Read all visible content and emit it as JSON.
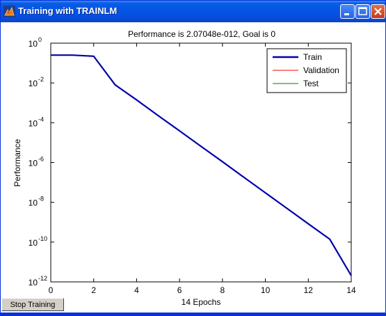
{
  "window": {
    "title": "Training with TRAINLM",
    "icon": "matlab-icon",
    "controls": [
      "minimize-icon",
      "maximize-icon",
      "close-icon"
    ]
  },
  "stop_button_label": "Stop Training",
  "chart_data": {
    "type": "line",
    "title": "Performance is 2.07048e-012, Goal is 0",
    "xlabel": "14 Epochs",
    "ylabel": "Performance",
    "xlim": [
      0,
      14
    ],
    "ylim": [
      1e-12,
      1
    ],
    "yscale": "log",
    "x_ticks": [
      0,
      2,
      4,
      6,
      8,
      10,
      12,
      14
    ],
    "y_tick_exponents": [
      0,
      -2,
      -4,
      -6,
      -8,
      -10,
      -12
    ],
    "grid": false,
    "legend_position": "top-right",
    "series": [
      {
        "name": "Train",
        "color": "#0000aa",
        "x": [
          0,
          1,
          2,
          3,
          4,
          5,
          6,
          7,
          8,
          9,
          10,
          11,
          12,
          13,
          14
        ],
        "y": [
          0.25,
          0.25,
          0.22,
          0.008,
          0.0014,
          0.00023,
          3.9e-05,
          6.5e-06,
          1.1e-06,
          1.8e-07,
          3e-08,
          5e-09,
          8.3e-10,
          1.4e-10,
          2.07048e-12
        ]
      },
      {
        "name": "Validation",
        "color": "#ff0000",
        "x": [],
        "y": []
      },
      {
        "name": "Test",
        "color": "#008000",
        "x": [],
        "y": []
      }
    ]
  }
}
